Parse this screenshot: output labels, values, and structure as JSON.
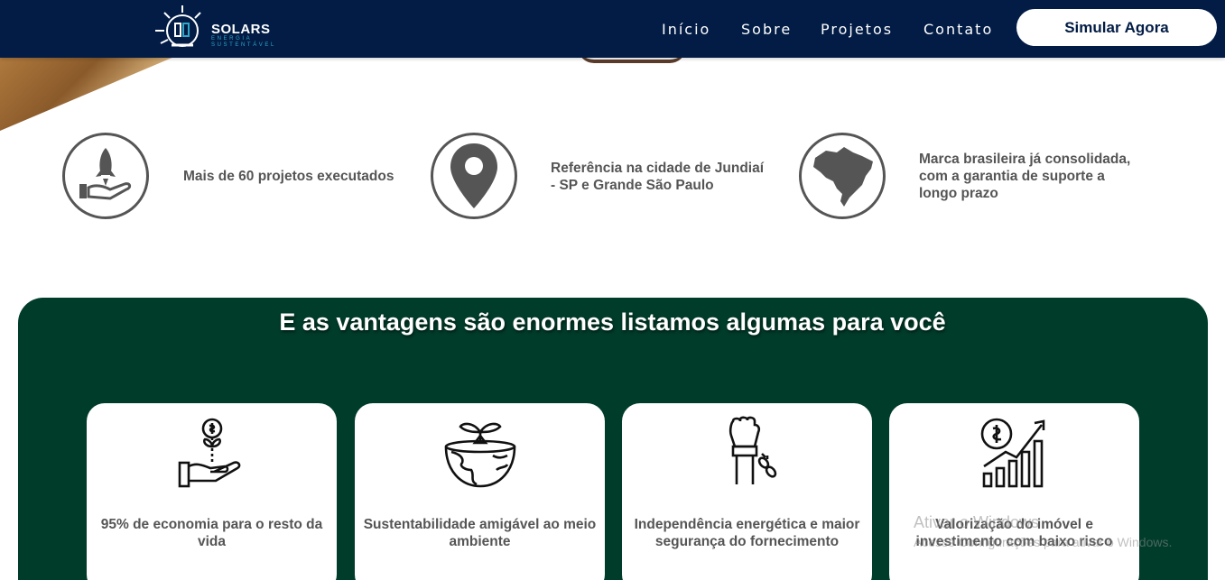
{
  "brand": {
    "name": "SOLARS",
    "tagline": "ENERGIA SUSTENTÁVEL"
  },
  "nav": [
    {
      "label": "Início"
    },
    {
      "label": "Sobre"
    },
    {
      "label": "Projetos"
    },
    {
      "label": "Contato"
    }
  ],
  "cta": {
    "label": "Simular Agora"
  },
  "features": [
    {
      "icon": "rocket-hand-icon",
      "text": "Mais de 60 projetos executados"
    },
    {
      "icon": "map-pin-icon",
      "text": "Referência na cidade de Jundiaí - SP e Grande São Paulo"
    },
    {
      "icon": "brazil-map-icon",
      "text": "Marca brasileira já consolidada, com a garantia de suporte a longo prazo"
    }
  ],
  "advantages": {
    "title": "E as vantagens são enormes listamos algumas para você",
    "cards": [
      {
        "icon": "money-plant-hand-icon",
        "text": "95% de economia para o resto da vida"
      },
      {
        "icon": "earth-sprout-icon",
        "text": "Sustentabilidade amigável ao meio ambiente"
      },
      {
        "icon": "broken-chain-fist-icon",
        "text": "Independência energética e maior segurança do fornecimento"
      },
      {
        "icon": "growth-chart-icon",
        "text": "Valorização do imóvel e investimento com baixo risco"
      }
    ]
  },
  "watermark": {
    "line1": "Ativar o Windows",
    "line2": "Acesse Configurações para ativar o Windows."
  },
  "colors": {
    "header": "#021c45",
    "green_section": "#003c2a",
    "text_gray": "#555555",
    "logo_accent": "#2fa8c8"
  }
}
